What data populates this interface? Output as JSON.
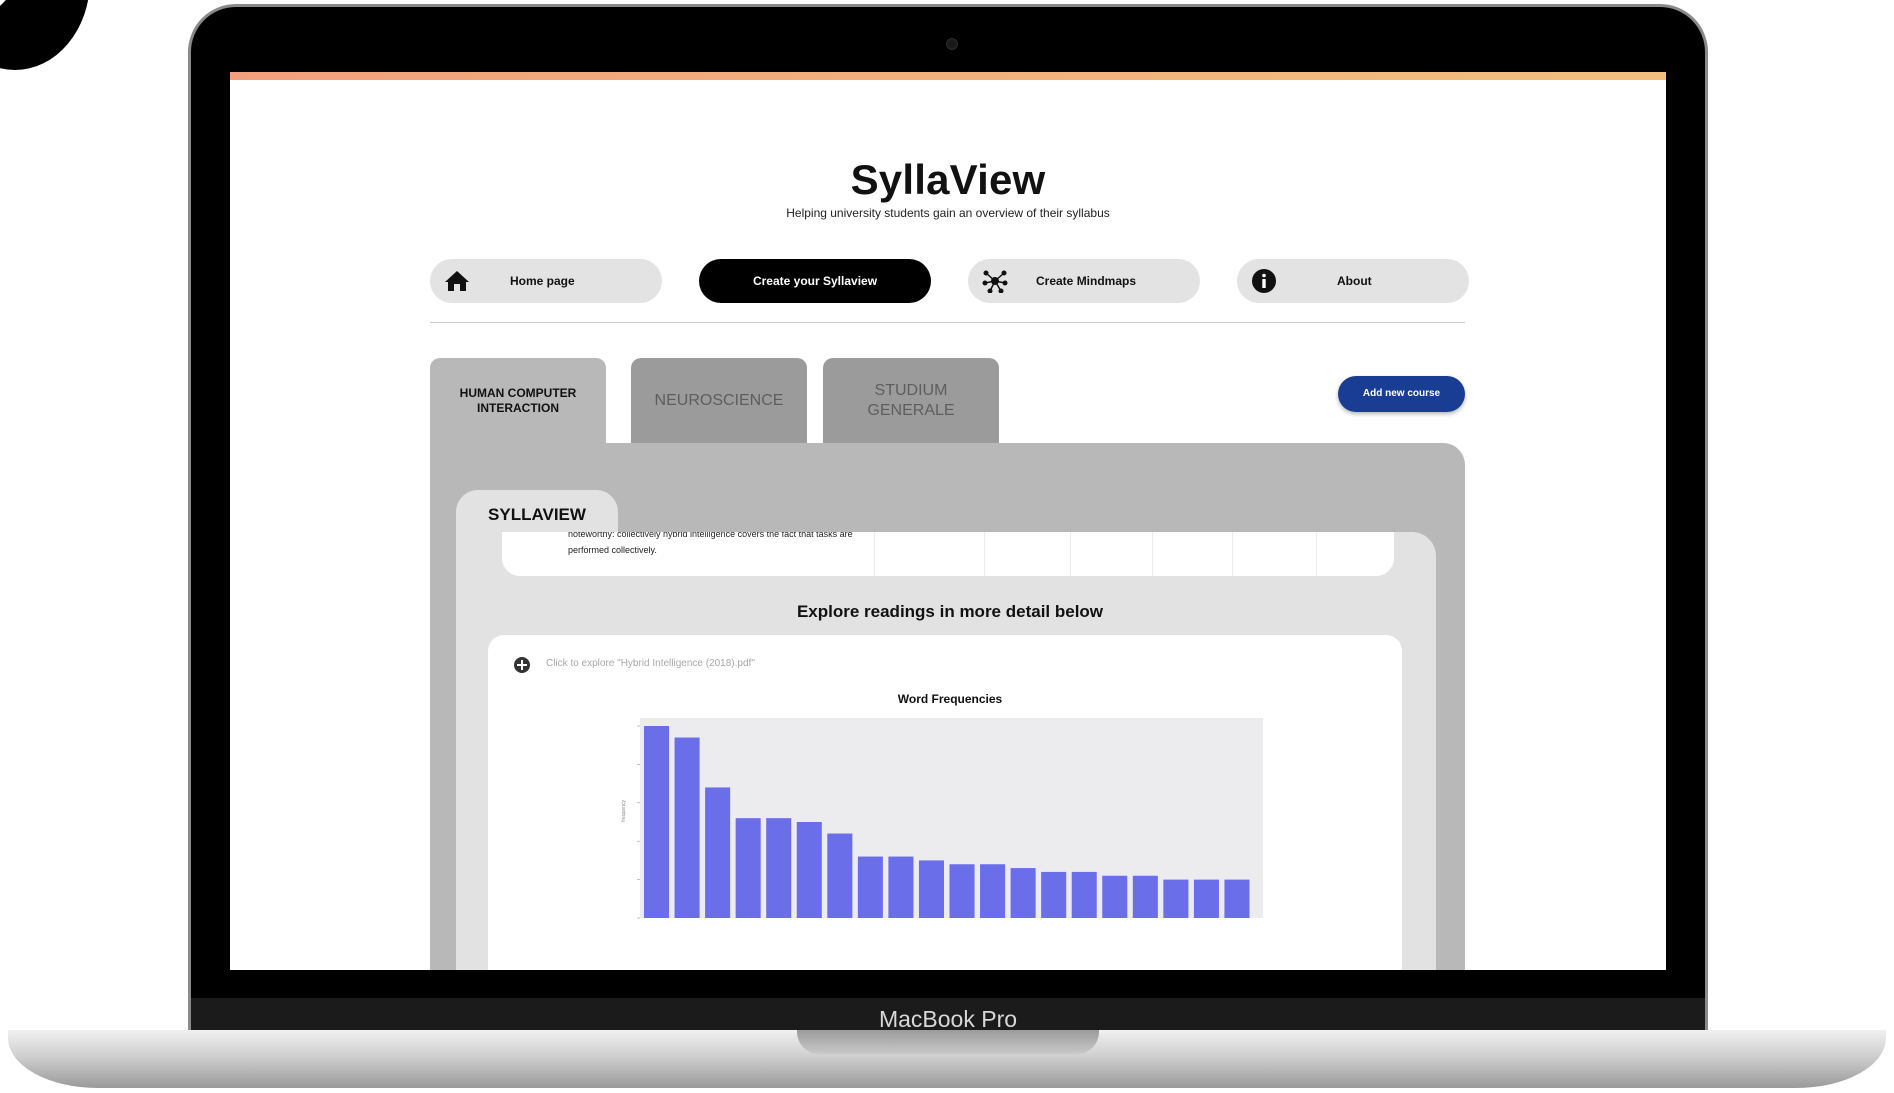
{
  "device": {
    "brand_label": "MacBook Pro"
  },
  "app": {
    "title": "SyllaView",
    "subtitle": "Helping university students gain an overview of their syllabus"
  },
  "nav": [
    {
      "label": "Home page",
      "icon": "home-icon"
    },
    {
      "label": "Create your Syllaview"
    },
    {
      "label": "Create Mindmaps",
      "icon": "mindmap-icon"
    },
    {
      "label": "About",
      "icon": "info-icon"
    }
  ],
  "course_tabs": [
    {
      "label": "HUMAN COMPUTER INTERACTION",
      "active": true
    },
    {
      "label": "NEUROSCIENCE",
      "active": false
    },
    {
      "label": "STUDIUM GENERALE",
      "active": false
    }
  ],
  "add_course_label": "Add new course",
  "syllaview_tab_label": "SYLLAVIEW",
  "reading_text": "noteworthy: collectively hybrid intelligence covers the fact that tasks are performed collectively.",
  "explore_heading": "Explore readings in more detail below",
  "reading_link": "Click to explore \"Hybrid Intelligence (2018).pdf\"",
  "colors": {
    "accent": "#1a3d94",
    "bars": "#6a6ee8",
    "panel": "#b8b8b8"
  },
  "chart_data": {
    "type": "bar",
    "title": "Word Frequencies",
    "ylabel": "frequency",
    "series": [
      {
        "values": [
          100,
          94,
          68,
          52,
          52,
          50,
          44,
          32,
          32,
          30,
          28,
          28,
          26,
          24,
          24,
          22,
          22,
          20,
          20,
          20
        ]
      }
    ],
    "ylim": [
      0,
      100
    ],
    "grid": false,
    "legend": "none"
  }
}
